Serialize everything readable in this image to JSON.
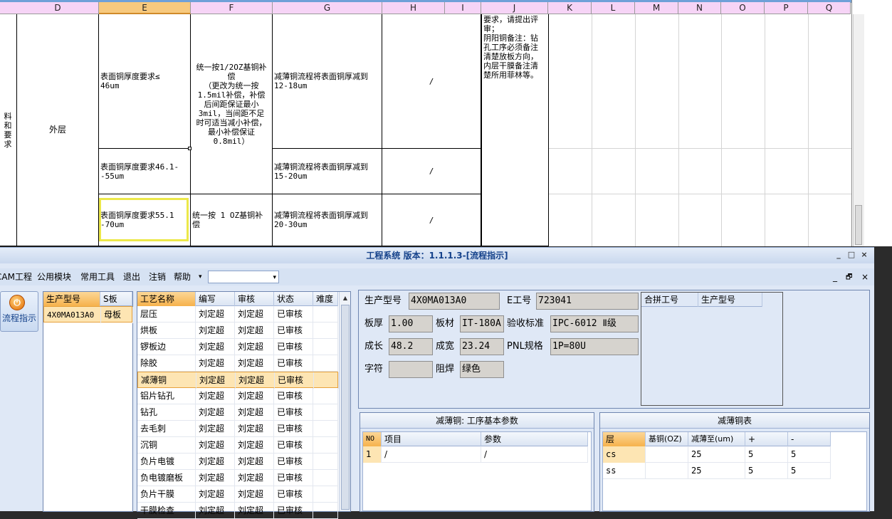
{
  "sheet": {
    "columns": [
      "D",
      "E",
      "F",
      "G",
      "H",
      "I",
      "J",
      "K",
      "L",
      "M",
      "N",
      "O",
      "P",
      "Q"
    ],
    "selected_column": "E",
    "left_partial": "料和\n要求",
    "d_value": "外层",
    "e1": "表面铜厚度要求≤\n46um",
    "e2": "表面铜厚度要求46.1-\n-55um",
    "e3": "表面铜厚度要求55.1\n-70um",
    "f1": "统一按1/2OZ基铜补\n偿\n（更改为统一按\n1.5mil补偿，补偿\n后间距保证最小\n3mil，当间距不足\n时可适当减小补偿，\n最小补偿保证\n0.8mil）",
    "f3": "统一按 1 OZ基铜补\n偿",
    "g1": "减薄铜流程将表面铜厚减到\n12-18um",
    "g2": "减薄铜流程将表面铜厚减到\n15-20um",
    "g3": "减薄铜流程将表面铜厚减到\n20-30um",
    "h1": "/",
    "h2": "/",
    "h3": "/",
    "j1": "要求，请提出评\n审；\n阴阳铜备注：钻\n孔工序必须备注\n清楚放板方向，\n内层干膜备注清\n楚所用菲林等。"
  },
  "app": {
    "title": "工程系统 版本：1.1.1.3-[流程指示]",
    "window_controls": [
      "_",
      "□",
      "×"
    ],
    "menu": [
      "CAM工程",
      "公用模块",
      "常用工具",
      "退出",
      "注销",
      "帮助"
    ],
    "help_arrow": "▾",
    "combo_value": "",
    "combo_arrow": "▾",
    "mdi_controls": [
      "_",
      "🗗",
      "×"
    ],
    "sidebar_label": "流程指示",
    "sidebar_icon": "power-icon"
  },
  "model_grid": {
    "headers": [
      "生产型号",
      "S板"
    ],
    "rows": [
      [
        "4X0MA013A0",
        "母板"
      ]
    ]
  },
  "process_grid": {
    "headers": [
      "工艺名称",
      "编写",
      "审核",
      "状态",
      "难度"
    ],
    "rows": [
      [
        "层压",
        "刘定超",
        "刘定超",
        "已审核",
        ""
      ],
      [
        "烘板",
        "刘定超",
        "刘定超",
        "已审核",
        ""
      ],
      [
        "锣板边",
        "刘定超",
        "刘定超",
        "已审核",
        ""
      ],
      [
        "除胶",
        "刘定超",
        "刘定超",
        "已审核",
        ""
      ],
      [
        "减薄铜",
        "刘定超",
        "刘定超",
        "已审核",
        ""
      ],
      [
        "铝片钻孔",
        "刘定超",
        "刘定超",
        "已审核",
        ""
      ],
      [
        "钻孔",
        "刘定超",
        "刘定超",
        "已审核",
        ""
      ],
      [
        "去毛刺",
        "刘定超",
        "刘定超",
        "已审核",
        ""
      ],
      [
        "沉铜",
        "刘定超",
        "刘定超",
        "已审核",
        ""
      ],
      [
        "负片电镀",
        "刘定超",
        "刘定超",
        "已审核",
        ""
      ],
      [
        "负电镀磨板",
        "刘定超",
        "刘定超",
        "已审核",
        ""
      ],
      [
        "负片干膜",
        "刘定超",
        "刘定超",
        "已审核",
        ""
      ],
      [
        "干膜检查",
        "刘定超",
        "刘定超",
        "已审核",
        ""
      ]
    ],
    "selected_index": 4
  },
  "info": {
    "model_label": "生产型号",
    "model_value": "4X0MA013A0",
    "e_label": "E工号",
    "e_value": "723041",
    "thick_label": "板厚",
    "thick_value": "1.00",
    "material_label": "板材",
    "material_value": "IT-180A",
    "accept_label": "验收标准",
    "accept_value": "IPC-6012 Ⅱ级",
    "length_label": "成长",
    "length_value": "48.2",
    "width_label": "成宽",
    "width_value": "23.24",
    "pnl_label": "PNL规格",
    "pnl_value": "1P=80U",
    "char_label": "字符",
    "char_value": "",
    "mask_label": "阻焊",
    "mask_value": "绿色",
    "pin_headers": [
      "合拼工号",
      "生产型号"
    ]
  },
  "params": {
    "title": "减薄铜: 工序基本参数",
    "headers": [
      "NO",
      "项目",
      "参数"
    ],
    "rows": [
      [
        "1",
        "/",
        "/"
      ]
    ]
  },
  "copper": {
    "title": "减薄铜表",
    "headers": [
      "层",
      "基铜(OZ)",
      "减薄至(um)",
      "+",
      "-"
    ],
    "rows": [
      [
        "cs",
        "",
        "25",
        "5",
        "5"
      ],
      [
        "ss",
        "",
        "25",
        "5",
        "5"
      ]
    ]
  }
}
